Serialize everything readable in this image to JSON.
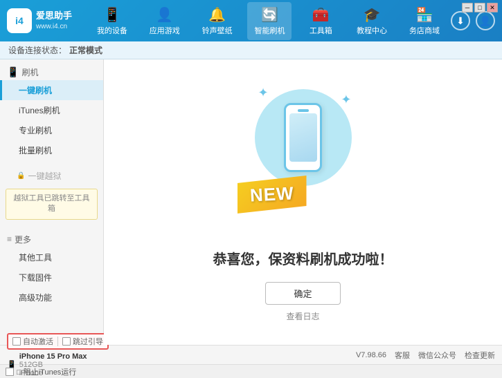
{
  "app": {
    "logo_text_line1": "爱思助手",
    "logo_text_line2": "www.i4.cn",
    "logo_char": "i4"
  },
  "nav": {
    "tabs": [
      {
        "id": "my-device",
        "icon": "📱",
        "label": "我的设备"
      },
      {
        "id": "app-games",
        "icon": "👤",
        "label": "应用游戏"
      },
      {
        "id": "ringtone",
        "icon": "🔔",
        "label": "铃声壁纸"
      },
      {
        "id": "smart-flash",
        "icon": "🔄",
        "label": "智能刷机",
        "active": true
      },
      {
        "id": "toolbox",
        "icon": "🧰",
        "label": "工具箱"
      },
      {
        "id": "tutorial",
        "icon": "🎓",
        "label": "教程中心"
      },
      {
        "id": "service",
        "icon": "🏪",
        "label": "务店商域"
      }
    ]
  },
  "status_bar": {
    "label": "设备连接状态：",
    "mode": "正常模式"
  },
  "sidebar": {
    "sections": [
      {
        "id": "flash",
        "icon": "📱",
        "label": "刷机",
        "items": [
          {
            "id": "one-key-flash",
            "label": "一键刷机",
            "active": true
          },
          {
            "id": "itunes-flash",
            "label": "iTunes刷机"
          },
          {
            "id": "pro-flash",
            "label": "专业刷机"
          },
          {
            "id": "batch-flash",
            "label": "批量刷机"
          }
        ]
      }
    ],
    "disabled_section": {
      "icon": "🔒",
      "label": "一键越狱",
      "notice": "越狱工具已跳转至工具箱"
    },
    "more_section": {
      "label": "更多",
      "items": [
        {
          "id": "other-tools",
          "label": "其他工具"
        },
        {
          "id": "download-firmware",
          "label": "下载固件"
        },
        {
          "id": "advanced",
          "label": "高级功能"
        }
      ]
    }
  },
  "content": {
    "new_badge": "NEW",
    "success_message": "恭喜您，保资料刷机成功啦！",
    "confirm_button": "确定",
    "log_button": "查看日志"
  },
  "bottom": {
    "auto_activate": "自动激活",
    "guide_activate": "跳过引导",
    "device_icon": "📱",
    "device_name": "iPhone 15 Pro Max",
    "device_storage": "512GB",
    "device_type": "iPhone",
    "version": "V7.98.66",
    "links": [
      {
        "id": "customer-service",
        "label": "客服"
      },
      {
        "id": "wechat",
        "label": "微信公众号"
      },
      {
        "id": "check-update",
        "label": "检查更新"
      }
    ],
    "itunes_bar": "□ 阻止iTunes运行"
  },
  "window_controls": {
    "minimize": "─",
    "maximize": "□",
    "close": "✕"
  }
}
